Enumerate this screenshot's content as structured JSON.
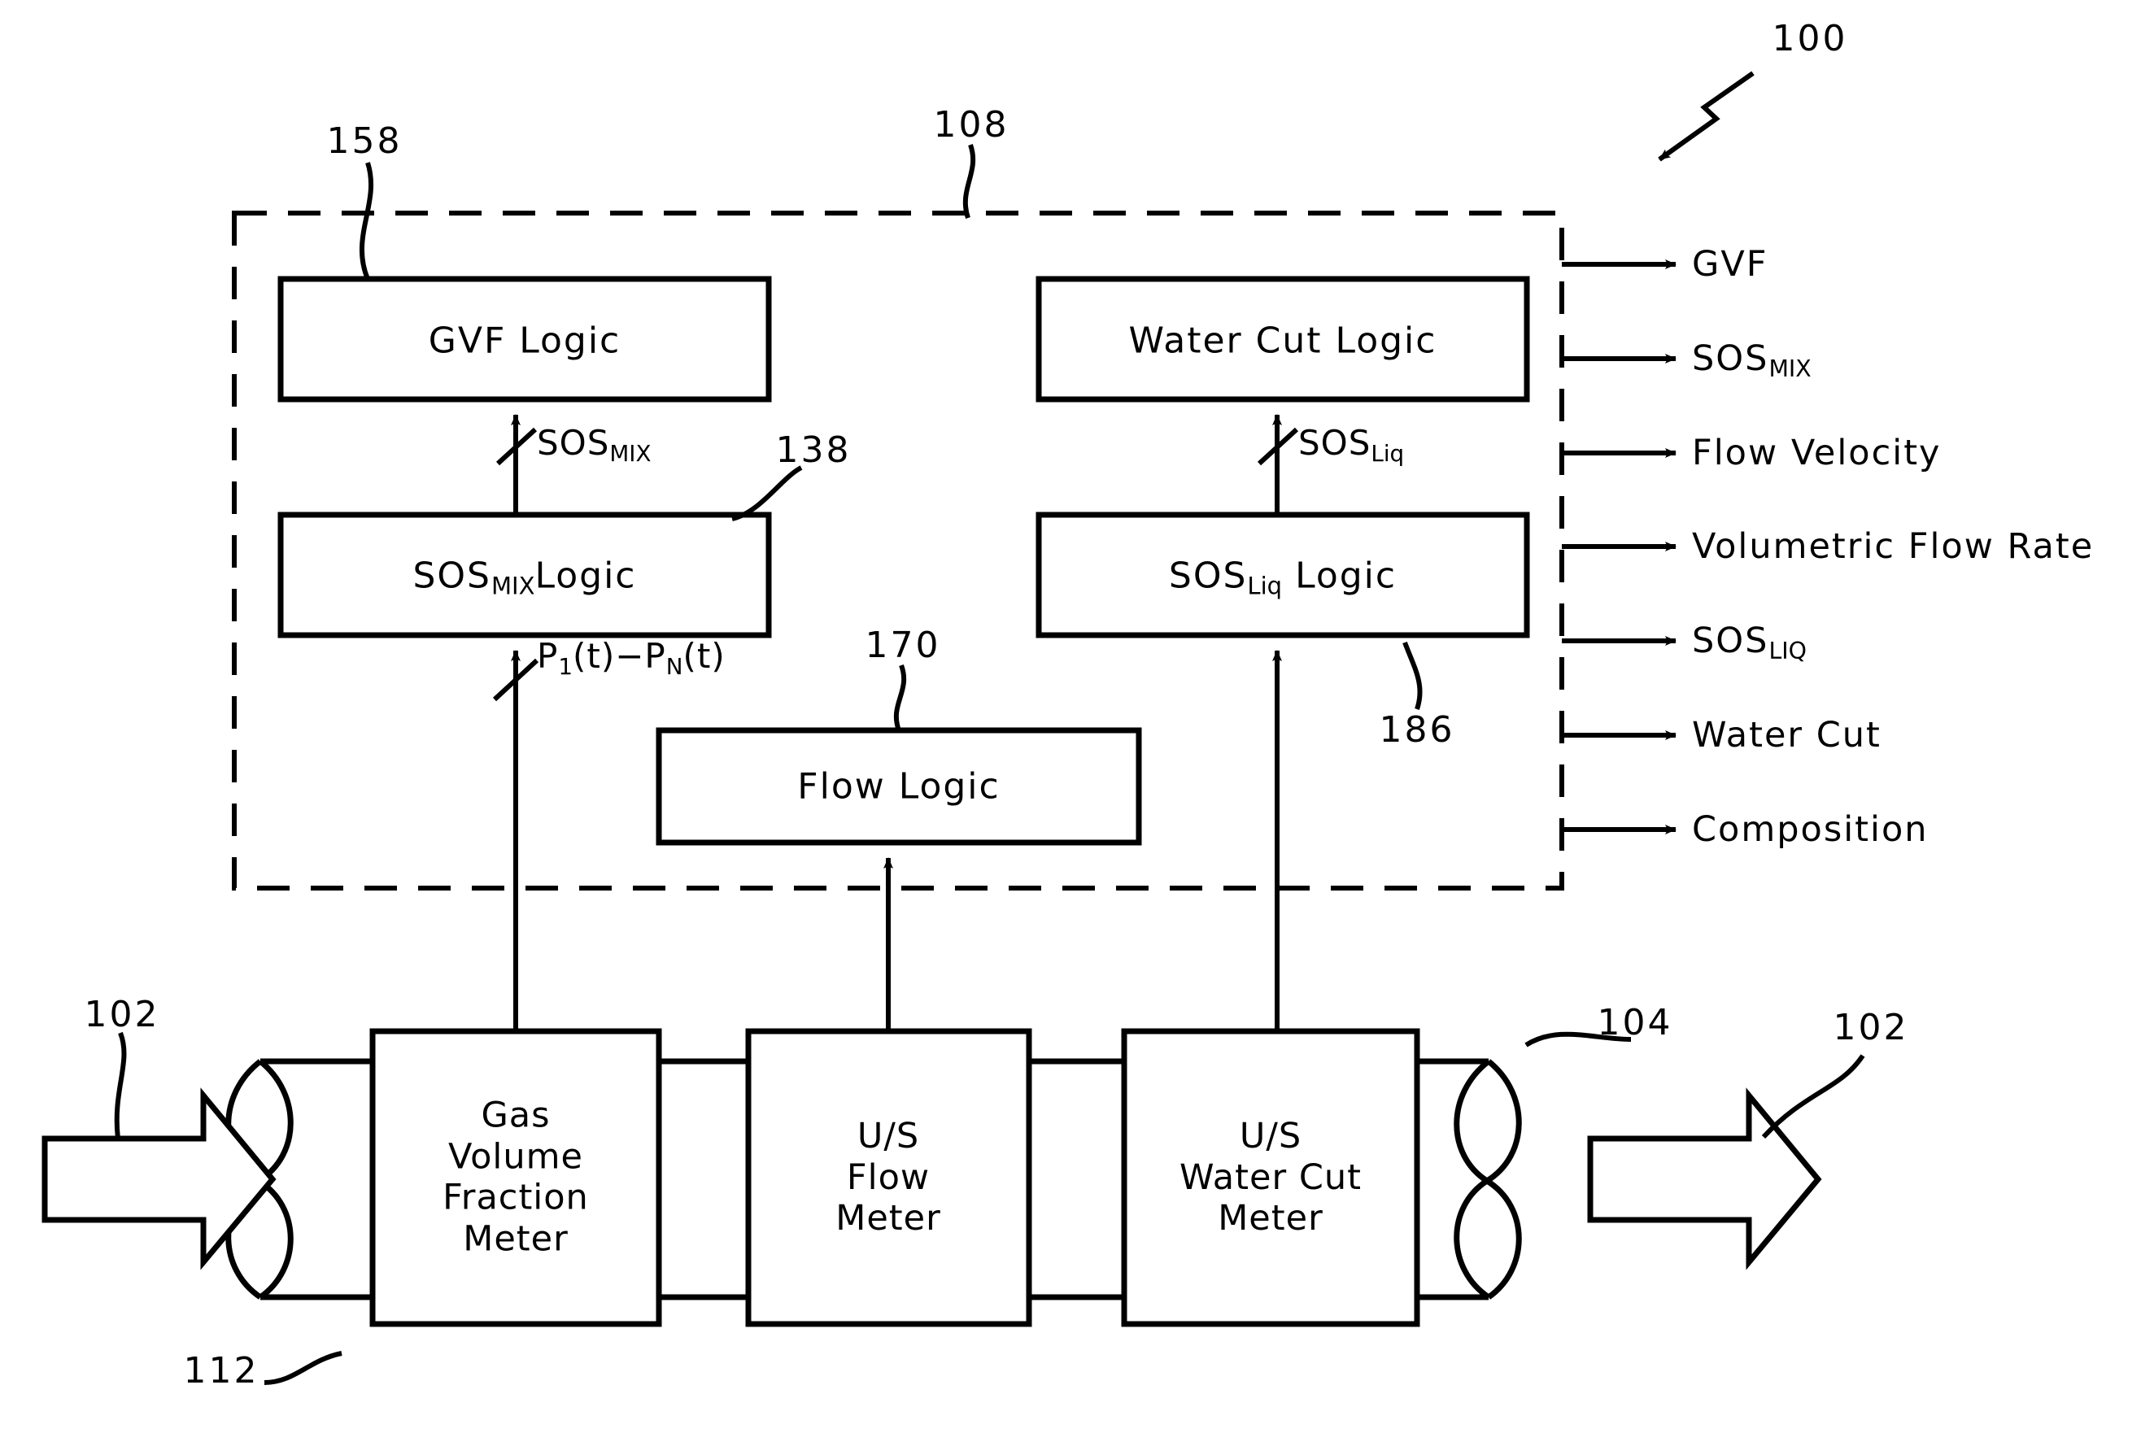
{
  "figure": {
    "title": "Multiphase flow measurement system block diagram",
    "reference_numbers": {
      "system": "100",
      "flow_inlet_outlet": "102",
      "pipe": "104",
      "processing_unit": "108",
      "pipe_inlet_section": "112",
      "sos_mix_logic": "138",
      "gvf_logic": "158",
      "flow_logic": "170",
      "sos_liq_logic": "186"
    }
  },
  "logic_boxes": [
    {
      "id": "gvf-logic",
      "label": "GVF  Logic"
    },
    {
      "id": "water-cut-logic",
      "label": "Water Cut Logic"
    },
    {
      "id": "sos-mix-logic",
      "label_main": "SOS",
      "label_sub": "MIX",
      "label_tail": "Logic"
    },
    {
      "id": "sos-liq-logic",
      "label_main": "SOS",
      "label_sub": "Liq",
      "label_tail": " Logic"
    },
    {
      "id": "flow-logic",
      "label": "Flow  Logic"
    }
  ],
  "meters": [
    {
      "id": "gas-volume-fraction-meter",
      "lines": [
        "Gas",
        "Volume",
        "Fraction",
        "Meter"
      ]
    },
    {
      "id": "us-flow-meter",
      "lines": [
        "U/S",
        "Flow",
        "Meter"
      ]
    },
    {
      "id": "us-water-cut-meter",
      "lines": [
        "U/S",
        "Water Cut",
        "Meter"
      ]
    }
  ],
  "signal_labels": {
    "sos_mix": {
      "main": "SOS",
      "sub": "MIX"
    },
    "sos_liq": {
      "main": "SOS",
      "sub": "Liq"
    },
    "pressures": {
      "p1": "P",
      "p1_sub": "1",
      "mid": "(t)−P",
      "pn_sub": "N",
      "tail": "(t)"
    }
  },
  "outputs": [
    {
      "id": "output-gvf",
      "label": "GVF",
      "sub": ""
    },
    {
      "id": "output-sos-mix",
      "label": "SOS",
      "sub": "MIX"
    },
    {
      "id": "output-flow-velocity",
      "label": "Flow  Velocity",
      "sub": ""
    },
    {
      "id": "output-volumetric-flow-rate",
      "label": "Volumetric  Flow  Rate",
      "sub": ""
    },
    {
      "id": "output-sos-liq",
      "label": "SOS",
      "sub": "LIQ"
    },
    {
      "id": "output-water-cut",
      "label": "Water  Cut",
      "sub": ""
    },
    {
      "id": "output-composition",
      "label": "Composition",
      "sub": ""
    }
  ],
  "colors": {
    "stroke": "#000000",
    "background": "#ffffff"
  }
}
